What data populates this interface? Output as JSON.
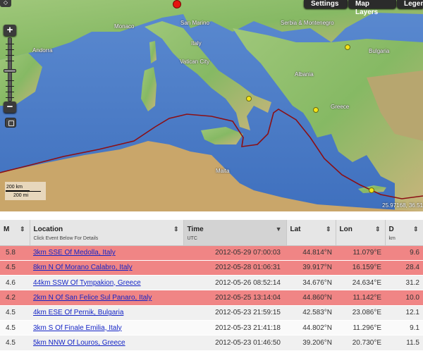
{
  "toolbar": {
    "settings_label": "Settings",
    "map_layers_label": "Map Layers",
    "legend_label": "Legen"
  },
  "map": {
    "labels": {
      "monaco": "Monaco",
      "san_marino": "San Marino",
      "serbia": "Serbia & Montenegro",
      "andorra": "Andorra",
      "italy": "Italy",
      "bulgaria": "Bulgaria",
      "vatican": "Vatican City",
      "albania": "Albania",
      "greece": "Greece",
      "malta": "Malta"
    },
    "scale_km": "200 km",
    "scale_mi": "200 mi",
    "coordinates": "25.97168, 36.51",
    "colors": {
      "sea": "#4f7fc6",
      "land": "#8fbf6b",
      "plate_boundary": "#8b0f14",
      "quake_minor": "#f4e417",
      "quake_major": "#e5140f"
    }
  },
  "table": {
    "columns": [
      {
        "name": "M",
        "sub": ""
      },
      {
        "name": "Location",
        "sub": "Click Event Below For Details"
      },
      {
        "name": "Time",
        "sub": "UTC"
      },
      {
        "name": "Lat",
        "sub": ""
      },
      {
        "name": "Lon",
        "sub": ""
      },
      {
        "name": "D",
        "sub": "km"
      }
    ],
    "rows": [
      {
        "mag": "5.8",
        "location": "3km SSE Of Medolla, Italy",
        "time": "2012-05-29 07:00:03",
        "lat": "44.814°N",
        "lon": "11.079°E",
        "depth": "9.6"
      },
      {
        "mag": "4.5",
        "location": "8km N Of Morano Calabro, Italy",
        "time": "2012-05-28 01:06:31",
        "lat": "39.917°N",
        "lon": "16.159°E",
        "depth": "28.4"
      },
      {
        "mag": "4.6",
        "location": "44km SSW Of Tympakion, Greece",
        "time": "2012-05-26 08:52:14",
        "lat": "34.676°N",
        "lon": "24.634°E",
        "depth": "31.2"
      },
      {
        "mag": "4.2",
        "location": "2km N Of San Felice Sul Panaro, Italy",
        "time": "2012-05-25 13:14:04",
        "lat": "44.860°N",
        "lon": "11.142°E",
        "depth": "10.0"
      },
      {
        "mag": "4.5",
        "location": "4km ESE Of Pernik, Bulgaria",
        "time": "2012-05-23 21:59:15",
        "lat": "42.583°N",
        "lon": "23.086°E",
        "depth": "12.1"
      },
      {
        "mag": "4.5",
        "location": "3km S Of Finale Emilia, Italy",
        "time": "2012-05-23 21:41:18",
        "lat": "44.802°N",
        "lon": "11.296°E",
        "depth": "9.1"
      },
      {
        "mag": "4.5",
        "location": "5km NNW Of Louros, Greece",
        "time": "2012-05-23 01:46:50",
        "lat": "39.206°N",
        "lon": "20.730°E",
        "depth": "11.5"
      }
    ]
  }
}
